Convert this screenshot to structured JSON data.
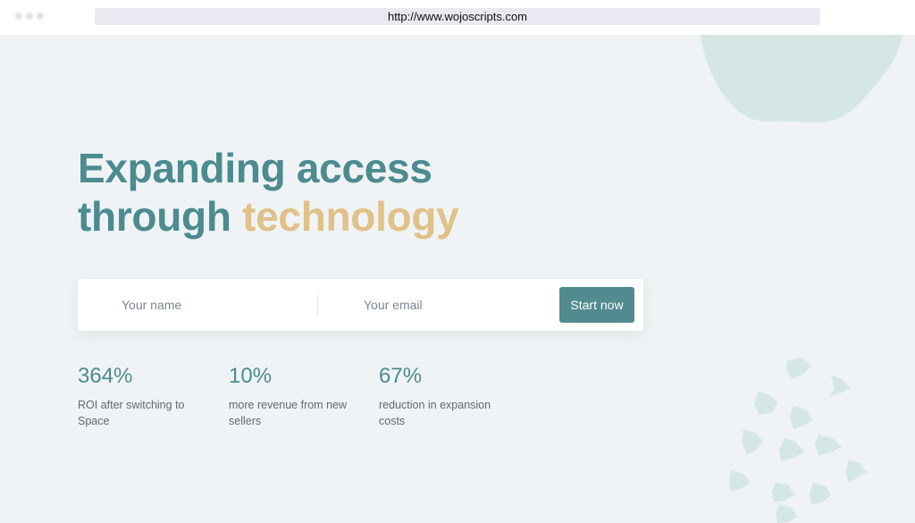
{
  "browser": {
    "url": "http://www.wojoscripts.com"
  },
  "hero": {
    "headline_line1": "Expanding access",
    "headline_line2_part1": "through",
    "headline_line2_accent": "technology"
  },
  "signup_form": {
    "name_placeholder": "Your name",
    "email_placeholder": "Your email",
    "submit_label": "Start now"
  },
  "stats": [
    {
      "value": "364%",
      "label": "ROI after switching to Space"
    },
    {
      "value": "10%",
      "label": "more revenue from new sellers"
    },
    {
      "value": "67%",
      "label": "reduction in expansion costs"
    }
  ],
  "colors": {
    "primary": "#4c8b8f",
    "accent": "#e0c188",
    "button": "#518b8f",
    "background": "#eff3f5",
    "decoration": "#d5e7e5"
  }
}
